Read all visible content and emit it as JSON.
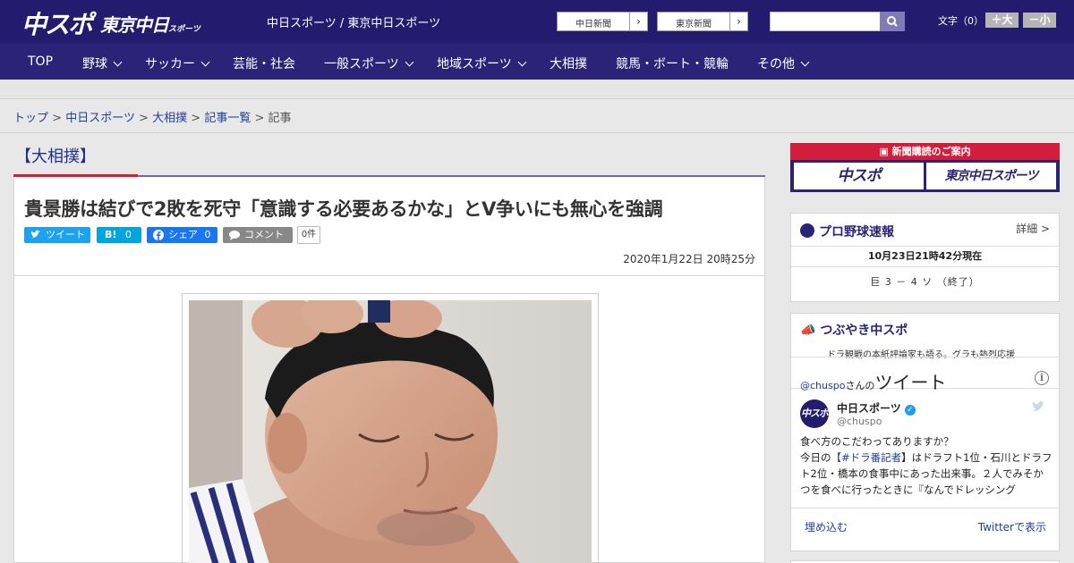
{
  "header": {
    "logo_chuspo": "中スポ",
    "logo_tokyo": "東京中日",
    "logo_tokyo_sub": "スポーツ",
    "site_names": "中日スポーツ / 東京中日スポーツ",
    "paper_links": [
      "中日新聞",
      "東京新聞"
    ],
    "search_placeholder": "",
    "font_size_label": "文字（0）",
    "font_larger": "＋大",
    "font_smaller": "－小"
  },
  "nav": [
    {
      "label": "TOP",
      "dropdown": false
    },
    {
      "label": "野球",
      "dropdown": true
    },
    {
      "label": "サッカー",
      "dropdown": true
    },
    {
      "label": "芸能・社会",
      "dropdown": false
    },
    {
      "label": "一般スポーツ",
      "dropdown": true
    },
    {
      "label": "地域スポーツ",
      "dropdown": true
    },
    {
      "label": "大相撲",
      "dropdown": false
    },
    {
      "label": "競馬・ボート・競輪",
      "dropdown": false
    },
    {
      "label": "その他",
      "dropdown": true
    }
  ],
  "breadcrumb": {
    "links": [
      "トップ",
      "中日スポーツ",
      "大相撲",
      "記事一覧"
    ],
    "current": "記事",
    "separator": ">"
  },
  "article": {
    "section": "【大相撲】",
    "headline": "貴景勝は結びで2敗を死守「意識する必要あるかな」とV争いにも無心を強調",
    "share": {
      "tweet": "ツイート",
      "hatena": "B!",
      "hatena_count": "0",
      "facebook": "シェア",
      "facebook_count": "0",
      "comment": "コメント",
      "comment_count": "0件"
    },
    "date": "2020年1月22日 20時25分"
  },
  "sidebar": {
    "subscribe": {
      "title": "新聞購読のご案内",
      "buttons": [
        "中スポ",
        "東京中日スポーツ"
      ]
    },
    "baseball": {
      "title": "プロ野球速報",
      "detail": "詳細 >",
      "as_of": "10月23日21時42分現在",
      "score": "巨 3 － 4 ソ （終了）"
    },
    "twitter": {
      "title": "つぶやき中スポ",
      "subtitle": "ドラ観戦の本紙評論家も語る。グラも熱烈応援",
      "widget_user": "@chuspo",
      "widget_user_suffix": "さんの",
      "widget_title": "ツイート",
      "tweet_name": "中日スポーツ",
      "tweet_handle": "@chuspo",
      "avatar_text": "中スポ",
      "tweet_text_1": "食べ方のこだわってありますか？",
      "tweet_text_2a": "今日の",
      "tweet_hashtag": "【#ドラ番記者",
      "tweet_text_2b": "】はドラフト1位・石川とドラフト2位・橋本の食事中にあった出来事。２人でみそかつを食べに行ったときに『なんでドレッシング",
      "embed": "埋め込む",
      "view_on": "Twitterで表示"
    }
  },
  "colors": {
    "header_bg": "#231c6e",
    "nav_bg": "#2a2378",
    "accent_red": "#d21d3c",
    "twitter_blue": "#1da1f2",
    "hatena_blue": "#00a4de",
    "facebook_blue": "#1877f2",
    "comment_gray": "#888888"
  }
}
